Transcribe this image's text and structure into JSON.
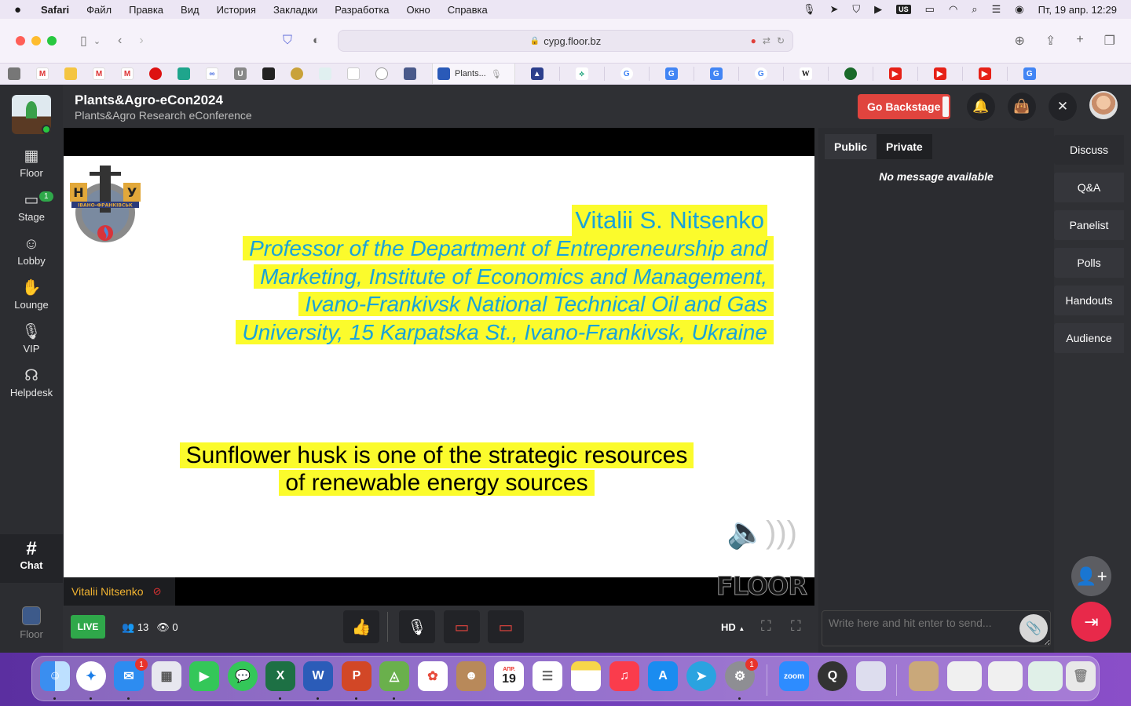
{
  "menubar": {
    "app": "Safari",
    "items": [
      "Файл",
      "Правка",
      "Вид",
      "История",
      "Закладки",
      "Разработка",
      "Окно",
      "Справка"
    ],
    "input_source": "US",
    "datetime": "Пт, 19 апр.  12:29"
  },
  "browser": {
    "url": "cypg.floor.bz",
    "active_tab_title": "Plants..."
  },
  "header": {
    "title": "Plants&Agro-eCon2024",
    "subtitle": "Plants&Agro Research eConference",
    "backstage_label": "Go Backstage"
  },
  "nav": {
    "items": [
      {
        "label": "Floor",
        "icon": "map-icon"
      },
      {
        "label": "Stage",
        "icon": "camera-icon",
        "badge": "1"
      },
      {
        "label": "Lobby",
        "icon": "people-icon"
      },
      {
        "label": "Lounge",
        "icon": "handshake-icon"
      },
      {
        "label": "VIP",
        "icon": "microphone-icon"
      },
      {
        "label": "Helpdesk",
        "icon": "headset-icon"
      }
    ],
    "chat_label": "Chat",
    "floor_label": "Floor"
  },
  "slide": {
    "speaker": "Vitalii S. Nitsenko",
    "affiliation_lines": [
      "Professor of the Department of Entrepreneurship and",
      "Marketing, Institute of Economics and Management,",
      "Ivano-Frankivsk National Technical Oil and Gas",
      "University, 15 Karpatska St., Ivano-Frankivsk, Ukraine"
    ],
    "topic_lines": [
      "Sunflower husk is one of the strategic resources",
      "of renewable energy sources"
    ],
    "emblem_letters": [
      "Н",
      "У"
    ],
    "emblem_city": "ІВАНО-ФРАНКІВСЬК",
    "watermark": "FLOOR"
  },
  "stage": {
    "speaker_tag": "Vitalii Nitsenko",
    "live_label": "LIVE",
    "attendees": "13",
    "viewers": "0",
    "quality": "HD"
  },
  "chat": {
    "tabs": [
      "Public",
      "Private"
    ],
    "empty_message": "No message available",
    "input_placeholder": "Write here and hit enter to send..."
  },
  "right_tabs": [
    "Discuss",
    "Q&A",
    "Panelist",
    "Polls",
    "Handouts",
    "Audience"
  ],
  "dock": {
    "mail_badge": "1",
    "settings_badge": "1",
    "calendar_month": "АПР.",
    "calendar_day": "19",
    "zoom_label": "zoom",
    "excel_letter": "X",
    "word_letter": "W",
    "powerpoint_letter": "P"
  },
  "colors": {
    "highlight": "#fbfb2c",
    "speaker_text": "#1aa3d8",
    "live": "#2fa84a",
    "backstage": "#e0443e",
    "exit": "#e8294a"
  }
}
